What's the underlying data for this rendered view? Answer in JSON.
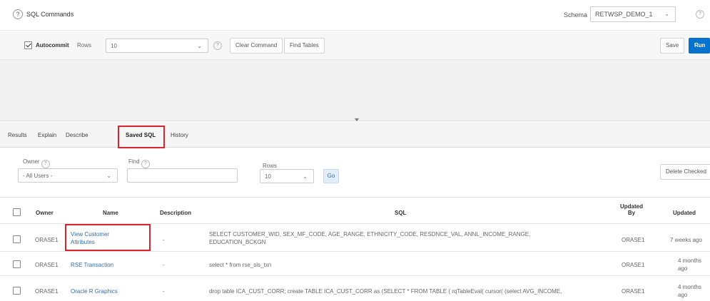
{
  "header": {
    "title": "SQL Commands",
    "help_icon": "help-circle-icon",
    "schema_label": "Schema",
    "schema_value": "RETWSP_DEMO_1"
  },
  "toolbar": {
    "autocommit_label": "Autocommit",
    "autocommit_checked": true,
    "rows_label": "Rows",
    "rows_value": "10",
    "clear_label": "Clear Command",
    "find_tables_label": "Find Tables",
    "save_label": "Save",
    "run_label": "Run"
  },
  "tabs": [
    {
      "label": "Results"
    },
    {
      "label": "Explain"
    },
    {
      "label": "Describe"
    },
    {
      "label": "Saved SQL",
      "active": true
    },
    {
      "label": "History"
    }
  ],
  "filters": {
    "owner_label": "Owner",
    "owner_value": "- All Users -",
    "find_label": "Find",
    "find_value": "",
    "rows_label": "Rows",
    "rows_value": "10",
    "go_label": "Go",
    "delete_checked_label": "Delete Checked"
  },
  "table": {
    "columns": [
      "Owner",
      "Name",
      "Description",
      "SQL",
      "Updated By",
      "Updated"
    ],
    "updated_by_line1": "Updated",
    "updated_by_line2": "By",
    "rows": [
      {
        "owner": "ORASE1",
        "name_line1": "View Customer",
        "name_line2": "Attributes",
        "description": "-",
        "sql_line1": "SELECT CUSTOMER_WID, SEX_MF_CODE, AGE_RANGE, ETHNICITY_CODE, RESDNCE_VAL, ANNL_INCOME_RANGE,",
        "sql_line2": "EDUCATION_BCKGN",
        "updated_by": "ORASE1",
        "updated_line1": "7 weeks ago",
        "updated_line2": ""
      },
      {
        "owner": "ORASE1",
        "name_line1": "RSE Transaction",
        "name_line2": "",
        "description": "-",
        "sql_line1": "select * from rse_sls_txn",
        "sql_line2": "",
        "updated_by": "ORASE1",
        "updated_line1": "4 months",
        "updated_line2": "ago"
      },
      {
        "owner": "ORASE1",
        "name_line1": "Oracle R Graphics",
        "name_line2": "",
        "description": "-",
        "sql_line1": "drop table ICA_CUST_CORR; create TABLE ICA_CUST_CORR as (SELECT * FROM TABLE ( rqTableEval( cursor( (select AVG_INCOME,",
        "sql_line2": "",
        "updated_by": "ORASE1",
        "updated_line1": "4 months",
        "updated_line2": "ago"
      }
    ]
  },
  "colors": {
    "accent": "#0572ce",
    "link": "#2e6fb3",
    "highlight": "#d9232e"
  }
}
